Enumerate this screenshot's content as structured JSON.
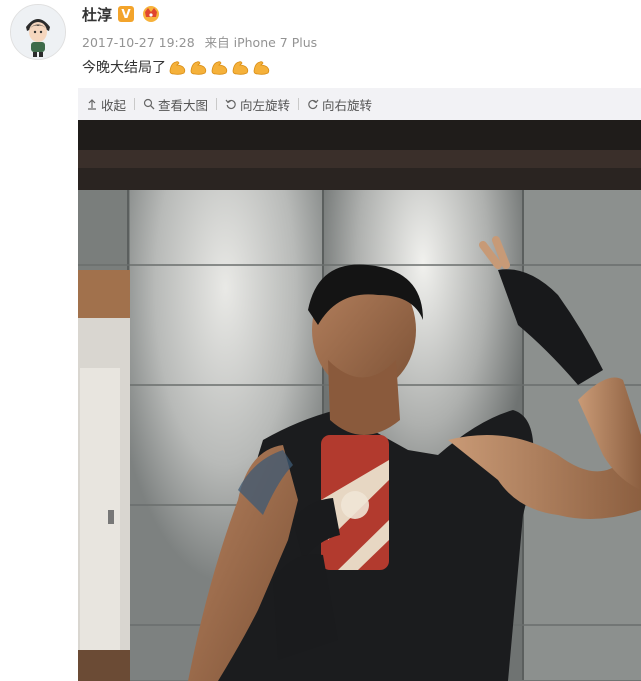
{
  "post": {
    "author_name": "杜淳",
    "timestamp": "2017-10-27 19:28",
    "source_prefix": "来自",
    "source_device": "iPhone 7 Plus",
    "verified_badge": "V",
    "crown_icon": "crown-icon",
    "text": "今晚大结局了",
    "emoji_name": "flexed-biceps-icon",
    "emoji_count": 5
  },
  "toolbar": {
    "collapse_label": "收起",
    "view_large_label": "查看大图",
    "rotate_left_label": "向左旋转",
    "rotate_right_label": "向右旋转"
  },
  "colors": {
    "toolbar_bg": "#f2f2f5",
    "badge_orange": "#f3a42b",
    "meta_gray": "#939393"
  }
}
